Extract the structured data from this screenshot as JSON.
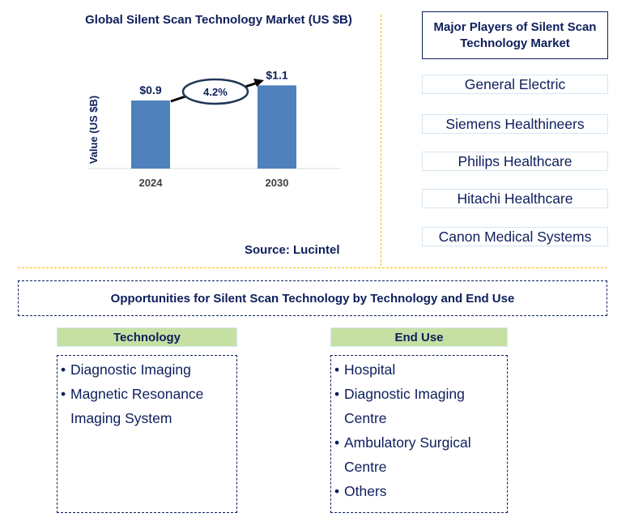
{
  "chart_data": {
    "type": "bar",
    "title": "Global Silent Scan Technology Market (US $B)",
    "xlabel": "",
    "ylabel": "Value (US $B)",
    "categories": [
      "2024",
      "2030"
    ],
    "values": [
      0.9,
      1.1
    ],
    "data_labels": [
      "$0.9",
      "$1.1"
    ],
    "ylim": [
      0,
      1.2
    ],
    "grid": false,
    "bar_color": "#4f81bd",
    "annotation": {
      "type": "cagr-arrow",
      "label": "4.2%"
    },
    "source": "Source: Lucintel"
  },
  "players": {
    "title": "Major Players of Silent Scan Technology Market",
    "items": [
      "General Electric",
      "Siemens Healthineers",
      "Philips Healthcare",
      "Hitachi Healthcare",
      "Canon Medical Systems"
    ]
  },
  "opportunities": {
    "title": "Opportunities for Silent Scan Technology by Technology and End Use",
    "segments": [
      {
        "header": "Technology",
        "items": [
          "Diagnostic Imaging",
          "Magnetic Resonance Imaging System"
        ]
      },
      {
        "header": "End Use",
        "items": [
          "Hospital",
          "Diagnostic Imaging Centre",
          "Ambulatory Surgical Centre",
          "Others"
        ]
      }
    ]
  },
  "colors": {
    "text": "#0d1f5c",
    "bar": "#4f81bd",
    "divider": "#f5b800",
    "segment_header_bg": "#c6e0a4"
  }
}
